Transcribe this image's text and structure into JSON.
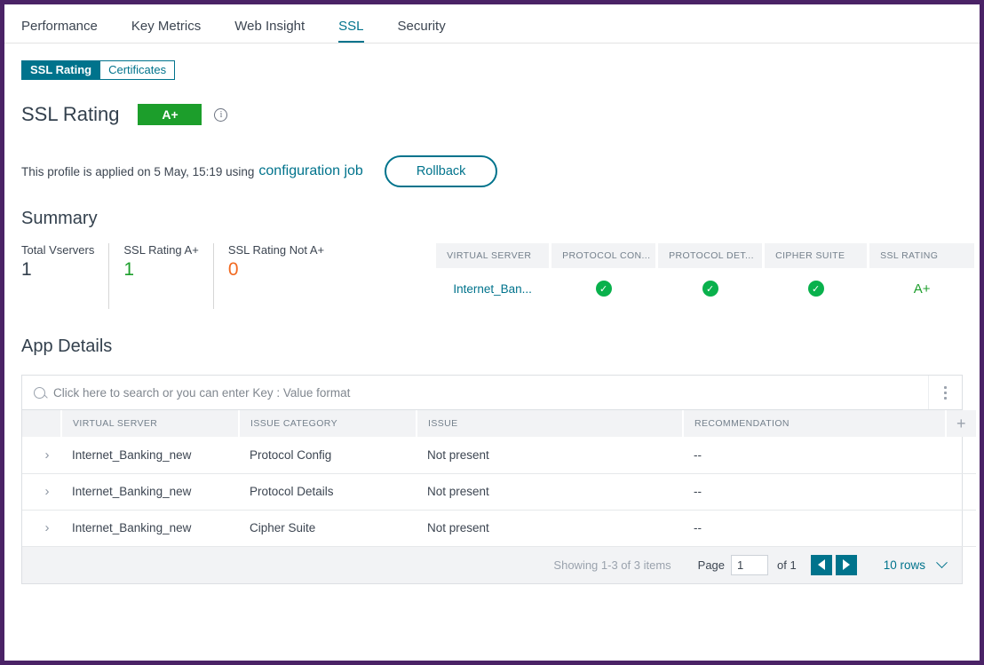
{
  "tabs": [
    {
      "label": "Performance",
      "active": false
    },
    {
      "label": "Key Metrics",
      "active": false
    },
    {
      "label": "Web Insight",
      "active": false
    },
    {
      "label": "SSL",
      "active": true
    },
    {
      "label": "Security",
      "active": false
    }
  ],
  "subtabs": {
    "ssl_rating": "SSL Rating",
    "certificates": "Certificates"
  },
  "header": {
    "title": "SSL Rating",
    "badge": "A+",
    "info_icon": "info-icon",
    "applied_text": "This profile is applied on 5 May, 15:19 using",
    "config_job_link": "configuration job",
    "rollback_label": "Rollback"
  },
  "summary": {
    "title": "Summary",
    "kpis": [
      {
        "label": "Total Vservers",
        "value": "1",
        "color": "default"
      },
      {
        "label": "SSL Rating A+",
        "value": "1",
        "color": "green"
      },
      {
        "label": "SSL Rating Not A+",
        "value": "0",
        "color": "orange"
      }
    ],
    "table": {
      "headers": [
        "VIRTUAL SERVER",
        "PROTOCOL CON...",
        "PROTOCOL DET...",
        "CIPHER SUITE",
        "SSL RATING"
      ],
      "row": {
        "virtual_server": "Internet_Ban...",
        "protocol_config": "check-circle-icon",
        "protocol_details": "check-circle-icon",
        "cipher_suite": "check-circle-icon",
        "ssl_rating": "A+"
      }
    }
  },
  "app_details": {
    "title": "App Details",
    "search": {
      "placeholder": "Click here to search or you can enter Key : Value format",
      "value": ""
    },
    "columns": [
      "",
      "VIRTUAL SERVER",
      "ISSUE CATEGORY",
      "ISSUE",
      "RECOMMENDATION",
      ""
    ],
    "rows": [
      {
        "expand": "›",
        "virtual_server": "Internet_Banking_new",
        "issue_category": "Protocol Config",
        "issue": "Not present",
        "recommendation": "--"
      },
      {
        "expand": "›",
        "virtual_server": "Internet_Banking_new",
        "issue_category": "Protocol Details",
        "issue": "Not present",
        "recommendation": "--"
      },
      {
        "expand": "›",
        "virtual_server": "Internet_Banking_new",
        "issue_category": "Cipher Suite",
        "issue": "Not present",
        "recommendation": "--"
      }
    ],
    "pagination": {
      "showing": "Showing 1-3 of 3 items",
      "page_label": "Page",
      "page_value": "1",
      "of_label": "of 1",
      "rows_per_page": "10 rows"
    }
  },
  "colors": {
    "frame_purple": "#4a2266",
    "teal": "#00738c",
    "green": "#1c9e2b",
    "check_green": "#09b14c",
    "orange": "#f26a21"
  }
}
